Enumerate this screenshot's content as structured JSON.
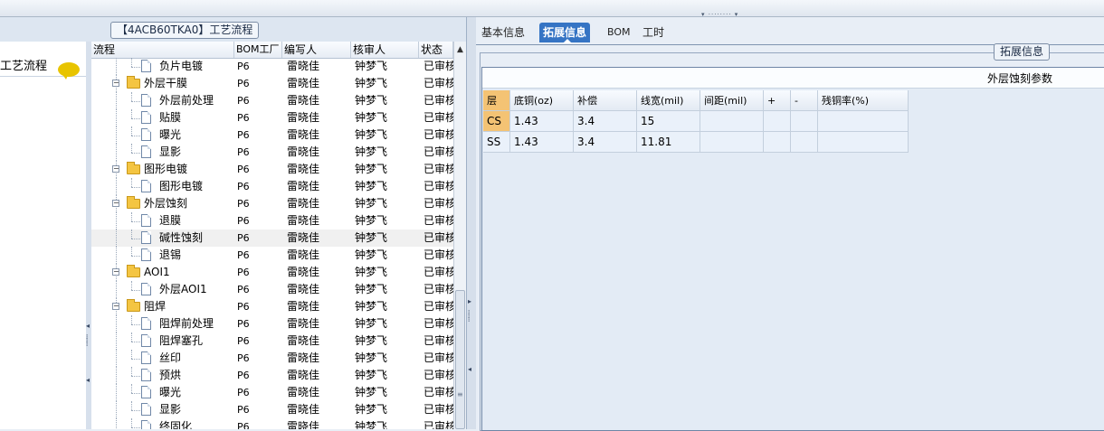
{
  "process_title": "【4ACB60TKA0】工艺流程",
  "sidebar": {
    "item_label": "工艺流程"
  },
  "tree": {
    "columns": {
      "flow": "流程",
      "bom": "BOM工厂",
      "writer": "编写人",
      "reviewer": "核审人",
      "status": "状态"
    },
    "rows": [
      {
        "label": "负片电镀",
        "type": "doc",
        "level": 2,
        "bom": "P6",
        "writer": "雷晓佳",
        "reviewer": "钟梦飞",
        "status": "已审核"
      },
      {
        "label": "外层干膜",
        "type": "folder",
        "level": 1,
        "bom": "P6",
        "writer": "雷晓佳",
        "reviewer": "钟梦飞",
        "status": "已审核"
      },
      {
        "label": "外层前处理",
        "type": "doc",
        "level": 2,
        "bom": "P6",
        "writer": "雷晓佳",
        "reviewer": "钟梦飞",
        "status": "已审核"
      },
      {
        "label": "贴膜",
        "type": "doc",
        "level": 2,
        "bom": "P6",
        "writer": "雷晓佳",
        "reviewer": "钟梦飞",
        "status": "已审核"
      },
      {
        "label": "曝光",
        "type": "doc",
        "level": 2,
        "bom": "P6",
        "writer": "雷晓佳",
        "reviewer": "钟梦飞",
        "status": "已审核"
      },
      {
        "label": "显影",
        "type": "doc",
        "level": 2,
        "bom": "P6",
        "writer": "雷晓佳",
        "reviewer": "钟梦飞",
        "status": "已审核"
      },
      {
        "label": "图形电镀",
        "type": "folder",
        "level": 1,
        "bom": "P6",
        "writer": "雷晓佳",
        "reviewer": "钟梦飞",
        "status": "已审核"
      },
      {
        "label": "图形电镀",
        "type": "doc",
        "level": 2,
        "bom": "P6",
        "writer": "雷晓佳",
        "reviewer": "钟梦飞",
        "status": "已审核"
      },
      {
        "label": "外层蚀刻",
        "type": "folder",
        "level": 1,
        "bom": "P6",
        "writer": "雷晓佳",
        "reviewer": "钟梦飞",
        "status": "已审核"
      },
      {
        "label": "退膜",
        "type": "doc",
        "level": 2,
        "bom": "P6",
        "writer": "雷晓佳",
        "reviewer": "钟梦飞",
        "status": "已审核"
      },
      {
        "label": "碱性蚀刻",
        "type": "doc",
        "level": 2,
        "bom": "P6",
        "writer": "雷晓佳",
        "reviewer": "钟梦飞",
        "status": "已审核",
        "selected": true
      },
      {
        "label": "退锡",
        "type": "doc",
        "level": 2,
        "bom": "P6",
        "writer": "雷晓佳",
        "reviewer": "钟梦飞",
        "status": "已审核"
      },
      {
        "label": "AOI1",
        "type": "folder",
        "level": 1,
        "bom": "P6",
        "writer": "雷晓佳",
        "reviewer": "钟梦飞",
        "status": "已审核"
      },
      {
        "label": "外层AOI1",
        "type": "doc",
        "level": 2,
        "bom": "P6",
        "writer": "雷晓佳",
        "reviewer": "钟梦飞",
        "status": "已审核"
      },
      {
        "label": "阻焊",
        "type": "folder",
        "level": 1,
        "bom": "P6",
        "writer": "雷晓佳",
        "reviewer": "钟梦飞",
        "status": "已审核"
      },
      {
        "label": "阻焊前处理",
        "type": "doc",
        "level": 2,
        "bom": "P6",
        "writer": "雷晓佳",
        "reviewer": "钟梦飞",
        "status": "已审核"
      },
      {
        "label": "阻焊塞孔",
        "type": "doc",
        "level": 2,
        "bom": "P6",
        "writer": "雷晓佳",
        "reviewer": "钟梦飞",
        "status": "已审核"
      },
      {
        "label": "丝印",
        "type": "doc",
        "level": 2,
        "bom": "P6",
        "writer": "雷晓佳",
        "reviewer": "钟梦飞",
        "status": "已审核"
      },
      {
        "label": "预烘",
        "type": "doc",
        "level": 2,
        "bom": "P6",
        "writer": "雷晓佳",
        "reviewer": "钟梦飞",
        "status": "已审核"
      },
      {
        "label": "曝光",
        "type": "doc",
        "level": 2,
        "bom": "P6",
        "writer": "雷晓佳",
        "reviewer": "钟梦飞",
        "status": "已审核"
      },
      {
        "label": "显影",
        "type": "doc",
        "level": 2,
        "bom": "P6",
        "writer": "雷晓佳",
        "reviewer": "钟梦飞",
        "status": "已审核"
      },
      {
        "label": "终固化",
        "type": "doc",
        "level": 2,
        "bom": "P6",
        "writer": "雷晓佳",
        "reviewer": "钟梦飞",
        "status": "已审核"
      }
    ]
  },
  "right": {
    "tabs": [
      "基本信息",
      "拓展信息",
      "BOM",
      "工时"
    ],
    "active_tab": 1,
    "ext_legend": "拓展信息",
    "section_title": "外层蚀刻参数",
    "grid": {
      "headers": [
        "层",
        "底铜(oz)",
        "补偿",
        "线宽(mil)",
        "间距(mil)",
        "+",
        "-",
        "残铜率(%)"
      ],
      "rows": [
        [
          "CS",
          "1.43",
          "3.4",
          "15",
          "",
          "",
          "",
          ""
        ],
        [
          "SS",
          "1.43",
          "3.4",
          "11.81",
          "",
          "",
          "",
          ""
        ]
      ]
    }
  }
}
